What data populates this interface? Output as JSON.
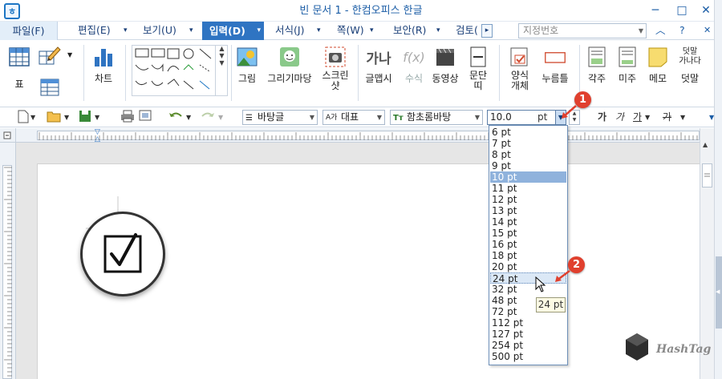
{
  "window": {
    "title": "빈 문서 1 - 한컴오피스 한글",
    "app_icon_glyph": "ㅎ",
    "minimize": "─",
    "maximize": "□",
    "close": "✕"
  },
  "menu": {
    "file": "파일(F)",
    "edit": "편집(E)",
    "view": "보기(U)",
    "insert": "입력(D)",
    "format": "서식(J)",
    "page": "쪽(W)",
    "security": "보안(R)",
    "review": "검토(",
    "more_glyph": "▸",
    "style_placeholder": "지정번호",
    "up_glyph": "︿",
    "help_glyph": "?",
    "close_glyph": "✕",
    "arrow_glyph": "▾"
  },
  "ribbon": {
    "table": "표",
    "chart": "차트",
    "picture": "그림",
    "drawing_mart": "그리기마당",
    "screenshot_l1": "스크린",
    "screenshot_l2": "샷",
    "font_cap": "글맵시",
    "font_cap_glyph": "가나",
    "formula": "수식",
    "formula_glyph": "f(x)",
    "video": "동영상",
    "paragraph_l1": "문단",
    "paragraph_l2": "띠",
    "form_l1": "양식",
    "form_l2": "개체",
    "stamp": "누름틀",
    "footnote": "각주",
    "endnote": "미주",
    "memo": "메모",
    "overlap_l1": "덧말",
    "overlap_sub": "가나다",
    "overlap_label": "덧말"
  },
  "toolbar": {
    "style": "바탕글",
    "language": "대표",
    "font": "함초롬바탕",
    "font_lead": "Tт",
    "lang_lead": "A가",
    "style_lead": "☰",
    "font_size": "10.0",
    "unit": "pt",
    "bold": "가",
    "italic": "가",
    "underline": "가",
    "strike": "가"
  },
  "font_size_dropdown": {
    "options": [
      "6 pt",
      "7 pt",
      "8 pt",
      "9 pt",
      "10 pt",
      "11 pt",
      "12 pt",
      "13 pt",
      "14 pt",
      "15 pt",
      "16 pt",
      "18 pt",
      "20 pt",
      "24 pt",
      "32 pt",
      "48 pt",
      "72 pt",
      "112 pt",
      "127 pt",
      "254 pt",
      "500 pt"
    ],
    "selected": "10 pt",
    "hovered": "24 pt",
    "tooltip": "24 pt"
  },
  "callouts": {
    "step1": "1",
    "step2": "2"
  },
  "watermark": {
    "text": "HashTag"
  },
  "colors": {
    "accent": "#2f74c2",
    "selected_option": "#8fb2dc",
    "callout": "#e0402e"
  }
}
